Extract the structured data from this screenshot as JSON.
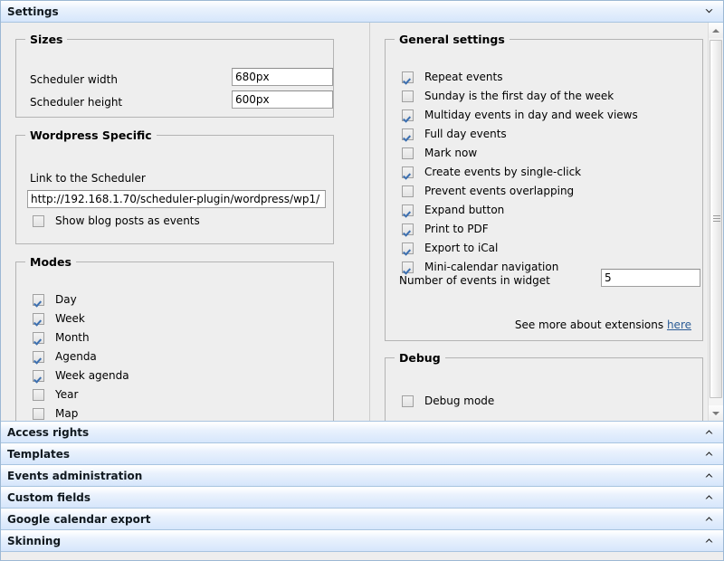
{
  "window": {
    "title": "Settings"
  },
  "accordion": {
    "expanded_icon": "chevron-down-icon",
    "collapsed_icon": "chevron-up-icon",
    "sections": [
      {
        "label": "Access rights"
      },
      {
        "label": "Templates"
      },
      {
        "label": "Events administration"
      },
      {
        "label": "Custom fields"
      },
      {
        "label": "Google calendar export"
      },
      {
        "label": "Skinning"
      }
    ]
  },
  "sizes": {
    "legend": "Sizes",
    "width_label": "Scheduler width",
    "width_value": "680px",
    "height_label": "Scheduler height",
    "height_value": "600px"
  },
  "wordpress": {
    "legend": "Wordpress Specific",
    "link_label": "Link to the Scheduler",
    "link_value": "http://192.168.1.70/scheduler-plugin/wordpress/wp1/",
    "show_blog_posts": {
      "label": "Show blog posts as events",
      "checked": false
    }
  },
  "modes": {
    "legend": "Modes",
    "items": [
      {
        "label": "Day",
        "checked": true
      },
      {
        "label": "Week",
        "checked": true
      },
      {
        "label": "Month",
        "checked": true
      },
      {
        "label": "Agenda",
        "checked": true
      },
      {
        "label": "Week agenda",
        "checked": true
      },
      {
        "label": "Year",
        "checked": false
      },
      {
        "label": "Map",
        "checked": false
      }
    ]
  },
  "general": {
    "legend": "General settings",
    "items": [
      {
        "label": "Repeat events",
        "checked": true
      },
      {
        "label": "Sunday is the first day of the week",
        "checked": false
      },
      {
        "label": "Multiday events in day and week views",
        "checked": true
      },
      {
        "label": "Full day events",
        "checked": true
      },
      {
        "label": "Mark now",
        "checked": false
      },
      {
        "label": "Create events by single-click",
        "checked": true
      },
      {
        "label": "Prevent events overlapping",
        "checked": false
      },
      {
        "label": "Expand button",
        "checked": true
      },
      {
        "label": "Print to PDF",
        "checked": true
      },
      {
        "label": "Export to iCal",
        "checked": true
      },
      {
        "label": "Mini-calendar navigation",
        "checked": true
      }
    ],
    "events_count_label": "Number of events in widget",
    "events_count_value": "5",
    "extensions_text": "See more about extensions",
    "extensions_link": "here"
  },
  "debug": {
    "legend": "Debug",
    "mode": {
      "label": "Debug mode",
      "checked": false
    }
  },
  "colors": {
    "header_accent": "#d6e6fb",
    "header_border": "#a8c4e0",
    "panel_bg": "#eeeeee",
    "check_mark": "#3c6fb0",
    "link": "#2b5c96"
  }
}
